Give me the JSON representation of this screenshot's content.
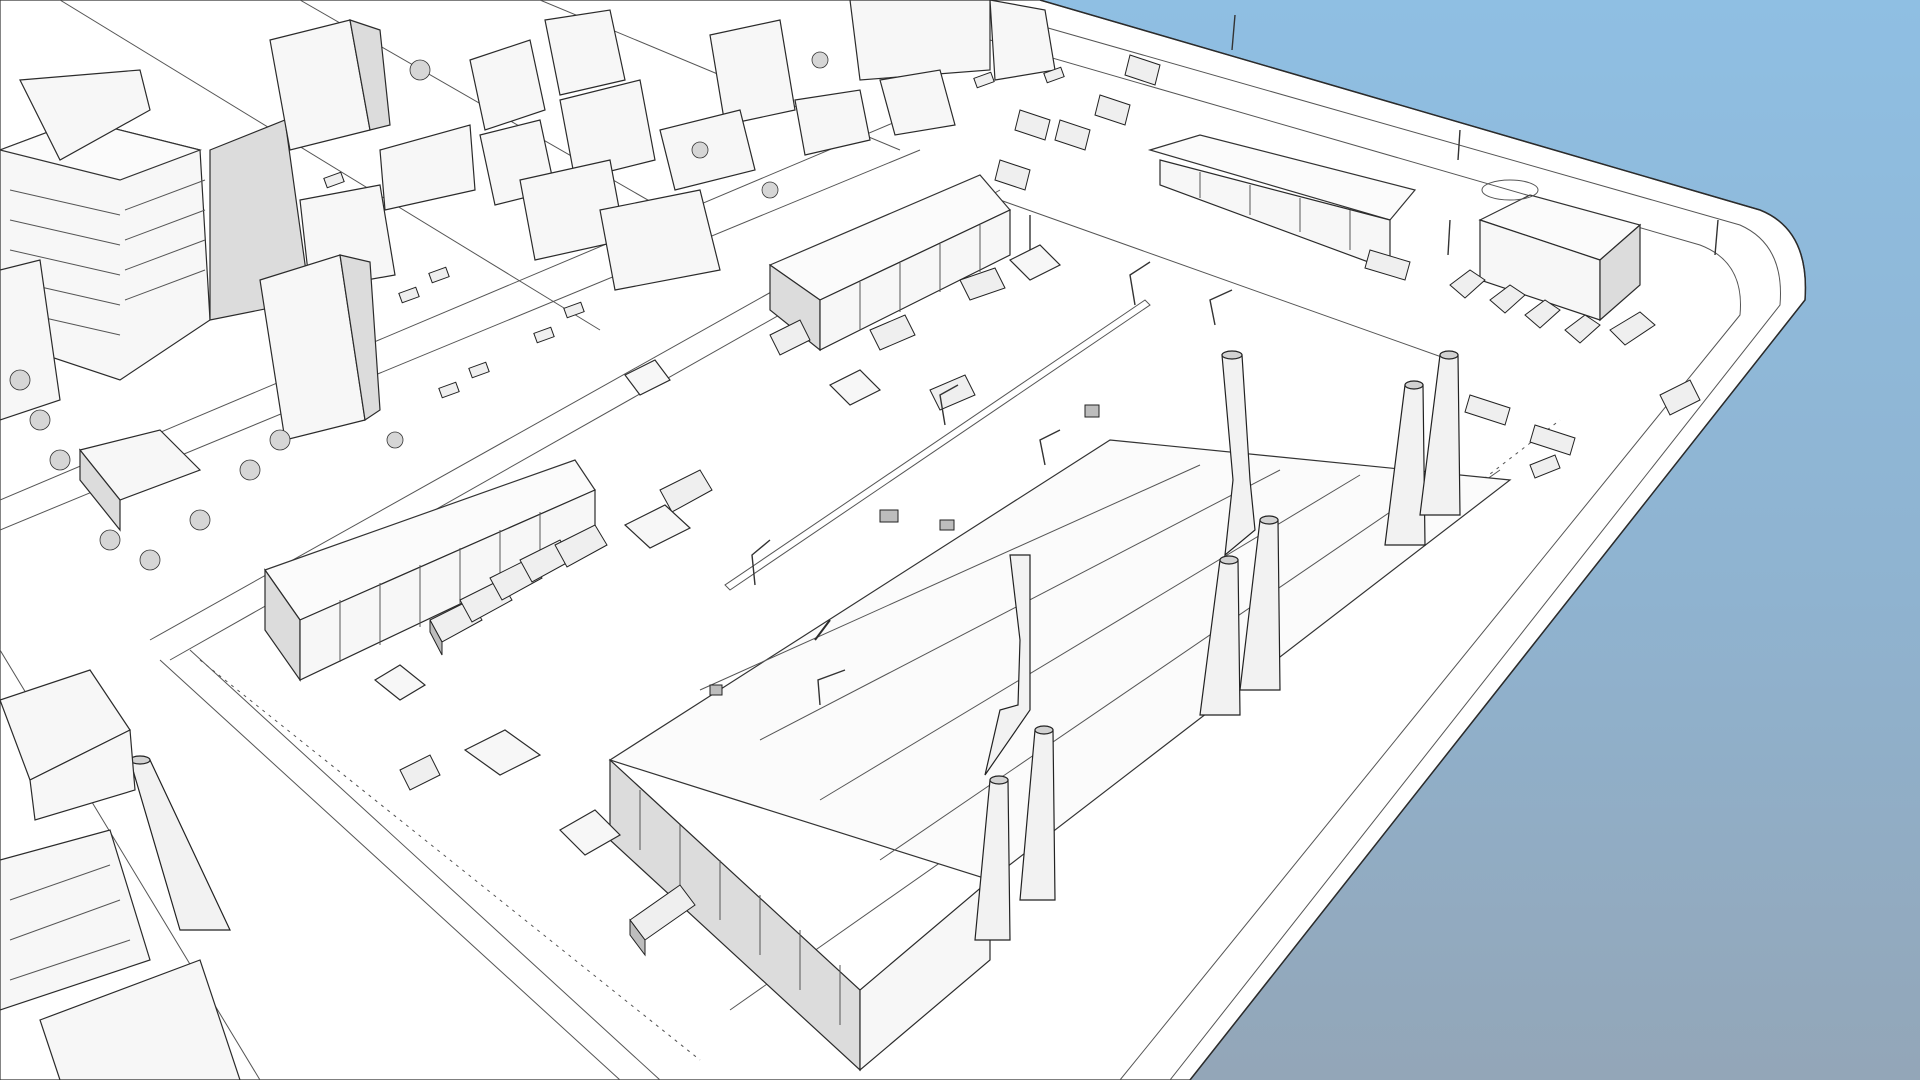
{
  "scene": {
    "water_color": "#8fb3d0",
    "sky_gradient": [
      "#8fbfe3",
      "#93a6b8"
    ],
    "ground_color": "#ffffff",
    "outline_color": "#2b2b2b"
  },
  "icons": {
    "smokestack": "smokestack-icon",
    "truck": "truck-icon",
    "streetlight": "streetlight-icon",
    "tree": "tree-icon"
  }
}
